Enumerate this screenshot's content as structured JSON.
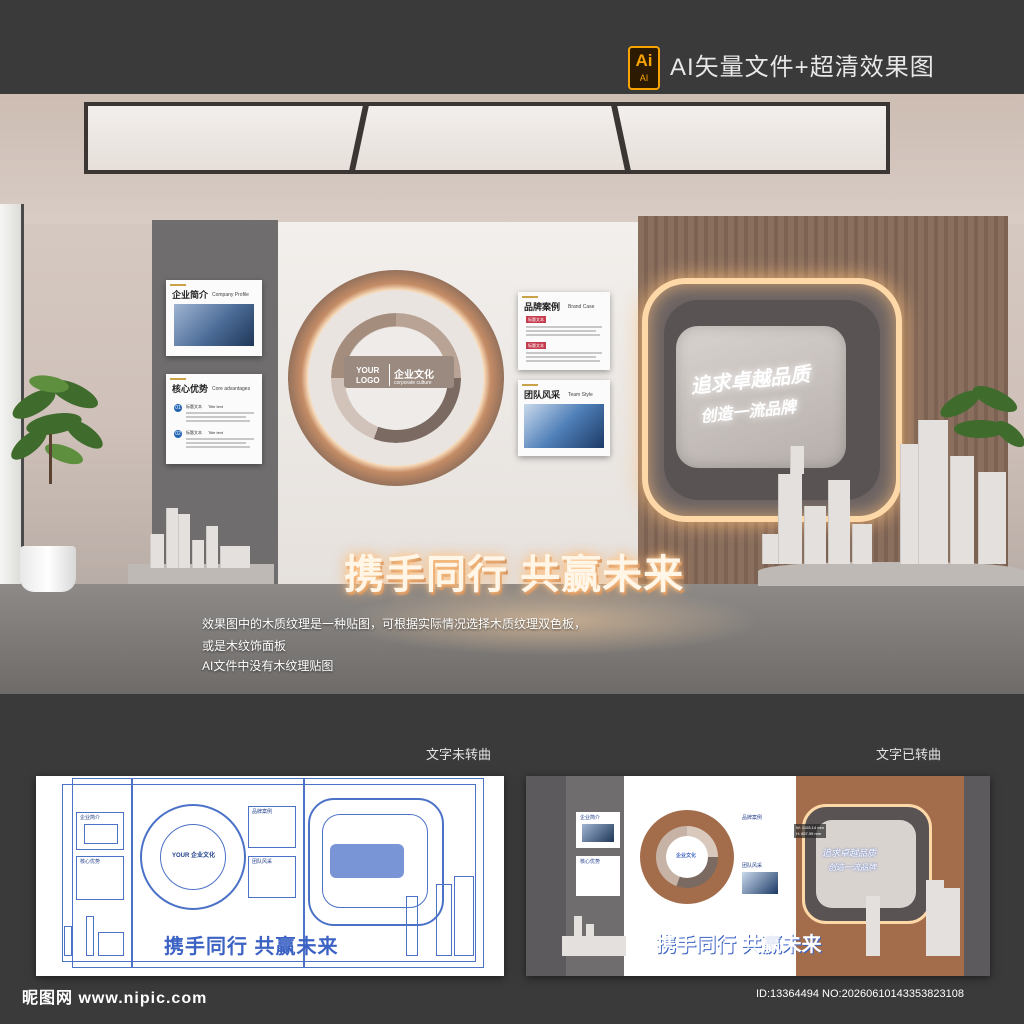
{
  "header": {
    "ai_badge_big": "Ai",
    "ai_badge_small": "AI",
    "title": "AI矢量文件+超清效果图"
  },
  "cards": {
    "profile_title": "企业简介",
    "profile_title_en": "Company Profile",
    "advantage_title": "核心优势",
    "advantage_title_en": "Core advantages",
    "advantage_item1_num": "01",
    "advantage_item1_label": "标题文本",
    "advantage_item1_en": "Title text",
    "advantage_item2_num": "02",
    "advantage_item2_label": "标题文本",
    "advantage_item2_en": "Title text",
    "brand_title": "品牌案例",
    "brand_title_en": "Brand Case",
    "brand_tag1": "标题文本",
    "brand_tag2": "标题文本",
    "team_title": "团队风采",
    "team_title_en": "Team Style"
  },
  "culture": {
    "logo_line1": "YOUR",
    "logo_line2": "LOGO",
    "title_cn": "企业文化",
    "title_en": "corporate culture"
  },
  "frame": {
    "slogan_line1": "追求卓越品质",
    "slogan_line2": "创造一流品牌"
  },
  "main_slogan": "携手同行 共赢未来",
  "notes": [
    "效果图中的木质纹理是一种贴图，可根据实际情况选择木质纹理双色板，",
    "或是木纹饰面板",
    "AI文件中没有木纹理贴图"
  ],
  "bottom": {
    "left_label": "文字未转曲",
    "right_label": "文字已转曲",
    "left_slogan": "携手同行 共赢未来",
    "right_slogan": "携手同行 共赢未来",
    "coord_w": "W: 1103.14 mm",
    "coord_h": "H: 857.95 mm"
  },
  "footer": {
    "site": "昵图网 www.nipic.com",
    "id": "ID:13364494 NO:20260610143353823108"
  },
  "colors": {
    "ai_orange": "#f7a400",
    "wire_blue": "#4c72c8",
    "glow": "#ffd8a8"
  }
}
